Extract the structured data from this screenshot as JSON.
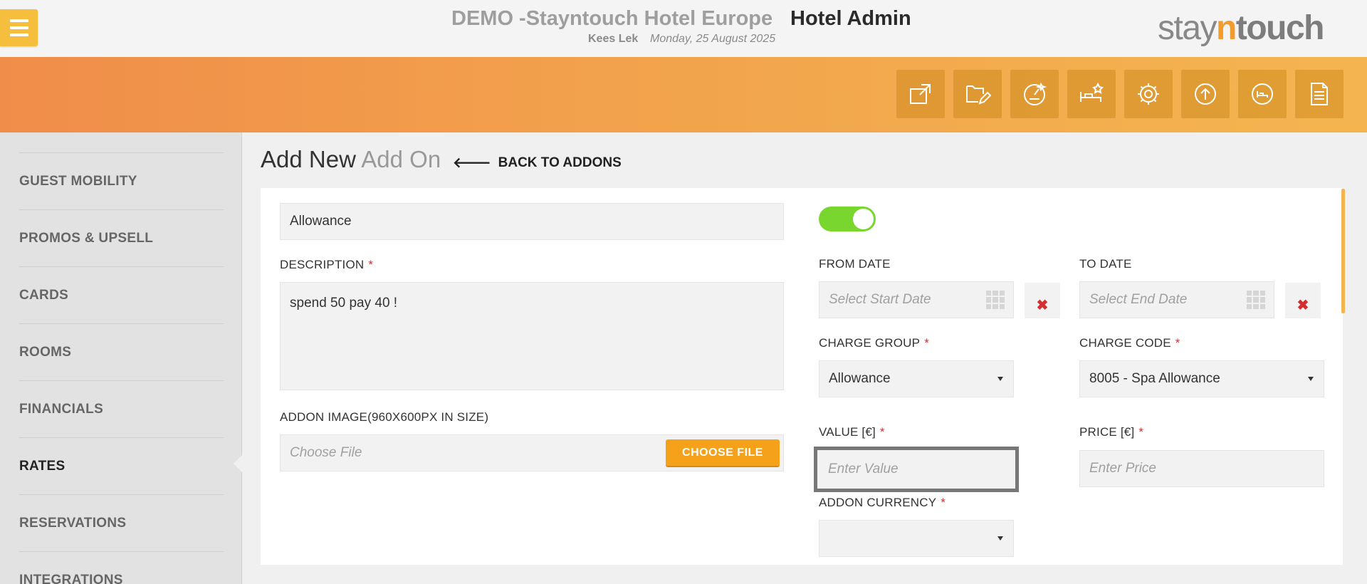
{
  "header": {
    "hotel_name": "DEMO -Stayntouch Hotel Europe",
    "app_title": "Hotel Admin",
    "user_name": "Kees Lek",
    "date": "Monday, 25 August 2025",
    "logo": {
      "stay": "stay",
      "n": "n",
      "touch": "touch"
    }
  },
  "toolbar": {
    "icons": [
      "external-link-icon",
      "folder-edit-icon",
      "dashboard-star-icon",
      "bed-star-icon",
      "settings-gear-icon",
      "upload-icon",
      "bed-icon",
      "document-icon"
    ]
  },
  "sidebar": {
    "items": [
      {
        "label": "GUEST MOBILITY"
      },
      {
        "label": "PROMOS & UPSELL"
      },
      {
        "label": "CARDS"
      },
      {
        "label": "ROOMS"
      },
      {
        "label": "FINANCIALS"
      },
      {
        "label": "RATES",
        "active": true
      },
      {
        "label": "RESERVATIONS"
      },
      {
        "label": "INTEGRATIONS"
      }
    ]
  },
  "page": {
    "title_main": "Add New",
    "title_sub": "Add On",
    "back_label": "BACK TO ADDONS"
  },
  "form": {
    "name_value": "Allowance",
    "description_label": "DESCRIPTION",
    "description_value": "spend 50 pay 40 !",
    "image_label": "ADDON IMAGE(960X600PX IN SIZE)",
    "image_placeholder": "Choose File",
    "choose_file_label": "CHOOSE FILE",
    "allowance_toggle_on": true,
    "from_date_label": "FROM DATE",
    "from_date_placeholder": "Select Start Date",
    "to_date_label": "TO DATE",
    "to_date_placeholder": "Select End Date",
    "clear_symbol": "✖",
    "charge_group_label": "CHARGE GROUP",
    "charge_group_value": "Allowance",
    "charge_code_label": "CHARGE CODE",
    "charge_code_value": "8005 - Spa Allowance",
    "value_label": "VALUE [€]",
    "value_placeholder": "Enter Value",
    "price_label": "PRICE [€]",
    "price_placeholder": "Enter Price",
    "currency_label": "ADDON CURRENCY",
    "currency_value": "",
    "required_mark": "*"
  },
  "colors": {
    "accent_orange": "#f6a11a",
    "toggle_green": "#79d62f",
    "required_red": "#d32f2f"
  }
}
